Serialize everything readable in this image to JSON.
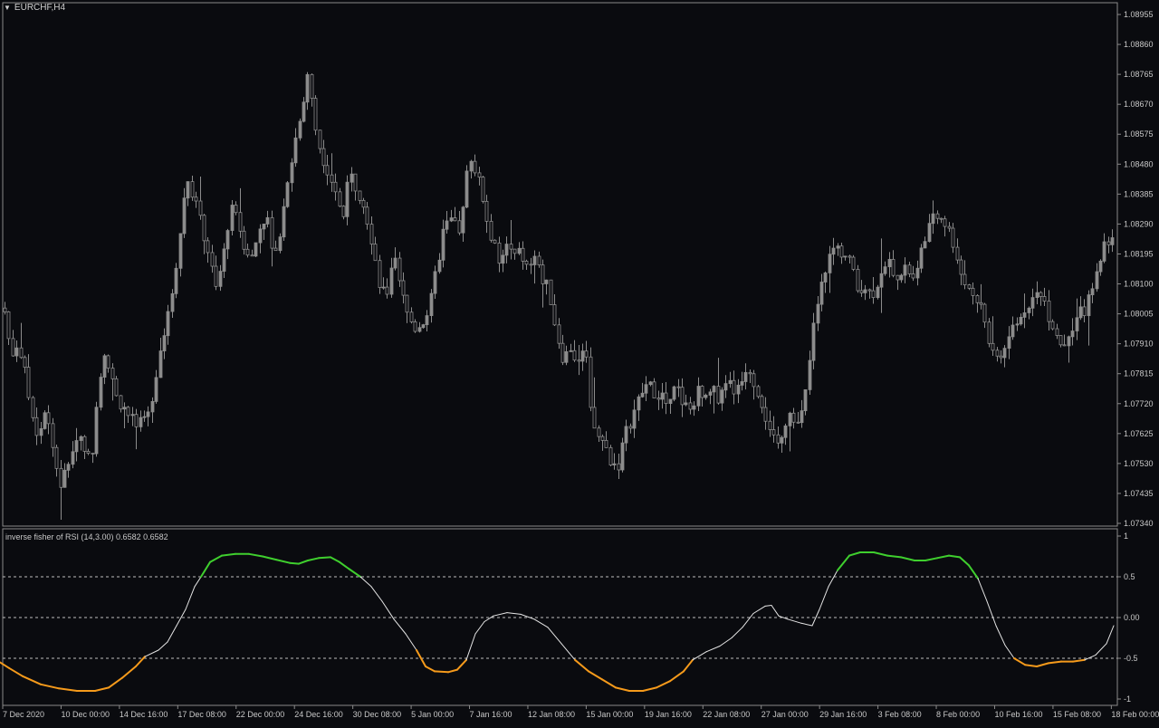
{
  "symbol": "EURCHF,H4",
  "indicator_label": "inverse fisher of RSI (14,3.00) 0.6582 0.6582",
  "colors": {
    "background": "#0a0b0f",
    "candle": "#8c8c8c",
    "frame": "#8a8a8a",
    "axis_text": "#c8c8c8",
    "line_neutral": "#e6e6e6",
    "line_overbought": "#3fcf2e",
    "line_oversold": "#f59a1b",
    "level_line": "#bdbdbd"
  },
  "chart_data": [
    {
      "type": "candlestick",
      "title": "EURCHF,H4",
      "y_ticks": [
        "1.08955",
        "1.08860",
        "1.08765",
        "1.08670",
        "1.08575",
        "1.08480",
        "1.08385",
        "1.08290",
        "1.08195",
        "1.08100",
        "1.08005",
        "1.07910",
        "1.07815",
        "1.07720",
        "1.07625",
        "1.07530",
        "1.07435",
        "1.07340"
      ],
      "ylim": [
        1.0734,
        1.08955
      ],
      "x_ticks": [
        "7 Dec 2020",
        "10 Dec 00:00",
        "14 Dec 16:00",
        "17 Dec 08:00",
        "22 Dec 00:00",
        "24 Dec 16:00",
        "30 Dec 08:00",
        "5 Jan 00:00",
        "7 Jan 16:00",
        "12 Jan 08:00",
        "15 Jan 00:00",
        "19 Jan 16:00",
        "22 Jan 08:00",
        "27 Jan 00:00",
        "29 Jan 16:00",
        "3 Feb 08:00",
        "8 Feb 00:00",
        "10 Feb 16:00",
        "15 Feb 08:00",
        "18 Feb 00:00"
      ],
      "close_path": [
        [
          0,
          1.0807
        ],
        [
          6,
          1.08
        ],
        [
          12,
          1.0787
        ],
        [
          20,
          1.0792
        ],
        [
          28,
          1.078
        ],
        [
          36,
          1.0768
        ],
        [
          42,
          1.0762
        ],
        [
          50,
          1.0772
        ],
        [
          58,
          1.0758
        ],
        [
          66,
          1.0746
        ],
        [
          74,
          1.0752
        ],
        [
          82,
          1.076
        ],
        [
          90,
          1.0762
        ],
        [
          100,
          1.0752
        ],
        [
          106,
          1.0772
        ],
        [
          114,
          1.079
        ],
        [
          120,
          1.0783
        ],
        [
          128,
          1.0774
        ],
        [
          138,
          1.077
        ],
        [
          150,
          1.0765
        ],
        [
          162,
          1.0766
        ],
        [
          170,
          1.0778
        ],
        [
          178,
          1.0792
        ],
        [
          186,
          1.08
        ],
        [
          194,
          1.0816
        ],
        [
          200,
          1.083
        ],
        [
          206,
          1.0844
        ],
        [
          214,
          1.0838
        ],
        [
          222,
          1.0828
        ],
        [
          230,
          1.082
        ],
        [
          238,
          1.0808
        ],
        [
          246,
          1.0818
        ],
        [
          254,
          1.0834
        ],
        [
          262,
          1.083
        ],
        [
          270,
          1.0822
        ],
        [
          278,
          1.0818
        ],
        [
          286,
          1.0828
        ],
        [
          294,
          1.0832
        ],
        [
          302,
          1.082
        ],
        [
          310,
          1.0828
        ],
        [
          318,
          1.0845
        ],
        [
          326,
          1.0856
        ],
        [
          334,
          1.0866
        ],
        [
          340,
          1.0878
        ],
        [
          346,
          1.0862
        ],
        [
          354,
          1.0852
        ],
        [
          362,
          1.0846
        ],
        [
          370,
          1.084
        ],
        [
          378,
          1.083
        ],
        [
          386,
          1.0845
        ],
        [
          394,
          1.084
        ],
        [
          402,
          1.0836
        ],
        [
          410,
          1.0822
        ],
        [
          418,
          1.081
        ],
        [
          426,
          1.0805
        ],
        [
          434,
          1.082
        ],
        [
          442,
          1.0808
        ],
        [
          450,
          1.08
        ],
        [
          458,
          1.0796
        ],
        [
          466,
          1.0798
        ],
        [
          474,
          1.0802
        ],
        [
          482,
          1.0815
        ],
        [
          490,
          1.0828
        ],
        [
          498,
          1.083
        ],
        [
          506,
          1.0826
        ],
        [
          512,
          1.0838
        ],
        [
          518,
          1.0852
        ],
        [
          526,
          1.0845
        ],
        [
          534,
          1.0836
        ],
        [
          542,
          1.0824
        ],
        [
          550,
          1.0818
        ],
        [
          558,
          1.0822
        ],
        [
          566,
          1.0818
        ],
        [
          574,
          1.082
        ],
        [
          582,
          1.0815
        ],
        [
          590,
          1.0818
        ],
        [
          598,
          1.0812
        ],
        [
          606,
          1.0808
        ],
        [
          614,
          1.0795
        ],
        [
          622,
          1.0786
        ],
        [
          630,
          1.079
        ],
        [
          638,
          1.0784
        ],
        [
          646,
          1.079
        ],
        [
          652,
          1.0772
        ],
        [
          658,
          1.0762
        ],
        [
          666,
          1.076
        ],
        [
          674,
          1.0754
        ],
        [
          682,
          1.0752
        ],
        [
          690,
          1.0762
        ],
        [
          698,
          1.0768
        ],
        [
          706,
          1.0774
        ],
        [
          714,
          1.0778
        ],
        [
          722,
          1.0776
        ],
        [
          730,
          1.0775
        ],
        [
          738,
          1.077
        ],
        [
          746,
          1.0778
        ],
        [
          754,
          1.0772
        ],
        [
          762,
          1.077
        ],
        [
          770,
          1.0776
        ],
        [
          778,
          1.0772
        ],
        [
          786,
          1.0776
        ],
        [
          794,
          1.0774
        ],
        [
          802,
          1.078
        ],
        [
          810,
          1.0776
        ],
        [
          818,
          1.078
        ],
        [
          826,
          1.0785
        ],
        [
          834,
          1.0778
        ],
        [
          842,
          1.0772
        ],
        [
          850,
          1.0762
        ],
        [
          858,
          1.0758
        ],
        [
          866,
          1.0766
        ],
        [
          874,
          1.077
        ],
        [
          882,
          1.0764
        ],
        [
          890,
          1.0776
        ],
        [
          898,
          1.0796
        ],
        [
          906,
          1.0808
        ],
        [
          914,
          1.0818
        ],
        [
          922,
          1.0822
        ],
        [
          930,
          1.082
        ],
        [
          938,
          1.0818
        ],
        [
          946,
          1.0808
        ],
        [
          954,
          1.081
        ],
        [
          962,
          1.0806
        ],
        [
          970,
          1.0812
        ],
        [
          978,
          1.0818
        ],
        [
          986,
          1.0815
        ],
        [
          994,
          1.0812
        ],
        [
          1002,
          1.0815
        ],
        [
          1010,
          1.081
        ],
        [
          1016,
          1.0818
        ],
        [
          1022,
          1.0826
        ],
        [
          1030,
          1.083
        ],
        [
          1038,
          1.0832
        ],
        [
          1046,
          1.0828
        ],
        [
          1054,
          1.0822
        ],
        [
          1062,
          1.0812
        ],
        [
          1070,
          1.0808
        ],
        [
          1078,
          1.0806
        ],
        [
          1086,
          1.08
        ],
        [
          1094,
          1.079
        ],
        [
          1102,
          1.0785
        ],
        [
          1110,
          1.079
        ],
        [
          1118,
          1.0796
        ],
        [
          1126,
          1.0798
        ],
        [
          1134,
          1.0804
        ],
        [
          1142,
          1.0806
        ],
        [
          1150,
          1.0808
        ],
        [
          1158,
          1.08
        ],
        [
          1166,
          1.0795
        ],
        [
          1174,
          1.079
        ],
        [
          1182,
          1.0796
        ],
        [
          1190,
          1.08
        ],
        [
          1198,
          1.0802
        ],
        [
          1206,
          1.0808
        ],
        [
          1214,
          1.0818
        ],
        [
          1222,
          1.0824
        ],
        [
          1230,
          1.0826
        ]
      ]
    },
    {
      "type": "line",
      "title": "inverse fisher of RSI (14,3.00) 0.6582 0.6582",
      "y_ticks": [
        "1",
        "0.5",
        "0.00",
        "-0.5",
        "-1"
      ],
      "ylim": [
        -1,
        1
      ],
      "levels": [
        0.5,
        0.0,
        -0.5
      ],
      "series": [
        {
          "name": "inverse fisher of RSI",
          "points": [
            [
              0,
              -0.55
            ],
            [
              10,
              -0.62
            ],
            [
              25,
              -0.72
            ],
            [
              45,
              -0.82
            ],
            [
              65,
              -0.87
            ],
            [
              85,
              -0.9
            ],
            [
              105,
              -0.9
            ],
            [
              120,
              -0.86
            ],
            [
              135,
              -0.74
            ],
            [
              150,
              -0.6
            ],
            [
              160,
              -0.48
            ],
            [
              175,
              -0.4
            ],
            [
              185,
              -0.3
            ],
            [
              195,
              -0.1
            ],
            [
              205,
              0.1
            ],
            [
              215,
              0.38
            ],
            [
              222,
              0.5
            ],
            [
              232,
              0.68
            ],
            [
              245,
              0.76
            ],
            [
              260,
              0.78
            ],
            [
              275,
              0.78
            ],
            [
              290,
              0.75
            ],
            [
              305,
              0.71
            ],
            [
              320,
              0.67
            ],
            [
              330,
              0.66
            ],
            [
              340,
              0.7
            ],
            [
              352,
              0.73
            ],
            [
              365,
              0.74
            ],
            [
              375,
              0.68
            ],
            [
              385,
              0.6
            ],
            [
              398,
              0.5
            ],
            [
              410,
              0.38
            ],
            [
              422,
              0.2
            ],
            [
              435,
              -0.02
            ],
            [
              448,
              -0.2
            ],
            [
              460,
              -0.4
            ],
            [
              470,
              -0.6
            ],
            [
              480,
              -0.66
            ],
            [
              495,
              -0.67
            ],
            [
              505,
              -0.64
            ],
            [
              515,
              -0.52
            ],
            [
              525,
              -0.2
            ],
            [
              535,
              -0.05
            ],
            [
              545,
              0.02
            ],
            [
              560,
              0.06
            ],
            [
              575,
              0.04
            ],
            [
              590,
              -0.02
            ],
            [
              605,
              -0.12
            ],
            [
              620,
              -0.32
            ],
            [
              635,
              -0.52
            ],
            [
              650,
              -0.66
            ],
            [
              665,
              -0.76
            ],
            [
              680,
              -0.86
            ],
            [
              695,
              -0.9
            ],
            [
              710,
              -0.9
            ],
            [
              725,
              -0.86
            ],
            [
              740,
              -0.78
            ],
            [
              755,
              -0.66
            ],
            [
              765,
              -0.52
            ],
            [
              780,
              -0.42
            ],
            [
              795,
              -0.35
            ],
            [
              808,
              -0.25
            ],
            [
              820,
              -0.12
            ],
            [
              832,
              0.05
            ],
            [
              845,
              0.14
            ],
            [
              852,
              0.15
            ],
            [
              860,
              0.02
            ],
            [
              870,
              -0.02
            ],
            [
              885,
              -0.07
            ],
            [
              897,
              -0.1
            ],
            [
              905,
              0.1
            ],
            [
              915,
              0.38
            ],
            [
              925,
              0.58
            ],
            [
              938,
              0.76
            ],
            [
              950,
              0.8
            ],
            [
              965,
              0.8
            ],
            [
              980,
              0.76
            ],
            [
              995,
              0.74
            ],
            [
              1010,
              0.7
            ],
            [
              1022,
              0.7
            ],
            [
              1035,
              0.73
            ],
            [
              1048,
              0.76
            ],
            [
              1060,
              0.74
            ],
            [
              1070,
              0.64
            ],
            [
              1080,
              0.48
            ],
            [
              1090,
              0.2
            ],
            [
              1100,
              -0.1
            ],
            [
              1110,
              -0.34
            ],
            [
              1120,
              -0.5
            ],
            [
              1132,
              -0.58
            ],
            [
              1145,
              -0.6
            ],
            [
              1158,
              -0.56
            ],
            [
              1172,
              -0.54
            ],
            [
              1185,
              -0.54
            ],
            [
              1198,
              -0.52
            ],
            [
              1210,
              -0.46
            ],
            [
              1222,
              -0.32
            ],
            [
              1230,
              -0.1
            ]
          ]
        }
      ]
    }
  ]
}
